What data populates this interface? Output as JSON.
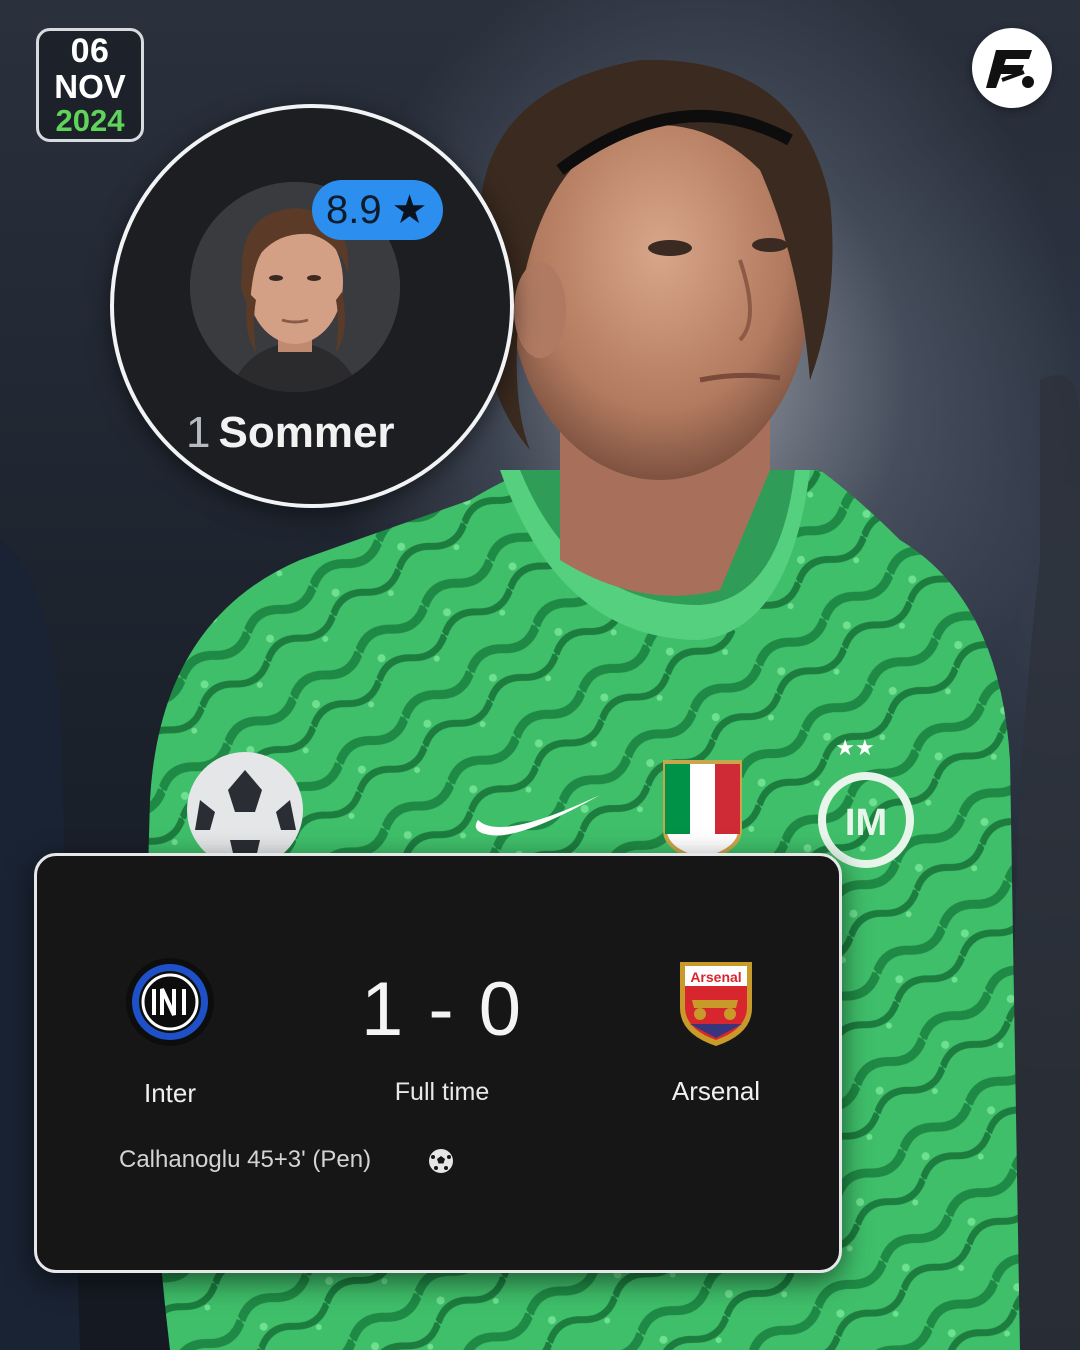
{
  "date": {
    "day": "06",
    "month": "NOV",
    "year": "2024"
  },
  "player": {
    "number": "1",
    "name": "Sommer",
    "rating": "8.9"
  },
  "match": {
    "home": "Inter",
    "away": "Arsenal",
    "score": "1 - 0",
    "status": "Full time",
    "scorer": "Calhanoglu 45+3' (Pen)",
    "away_crest_text": "Arsenal"
  },
  "icons": {
    "rating": "star-icon",
    "goal": "soccer-ball-icon",
    "brand": "brand-logo-icon"
  },
  "colors": {
    "accent_green": "#5fd35a",
    "rating_blue": "#2c8ff0",
    "card_bg": "#161616",
    "jersey_green": "#34b25f"
  }
}
